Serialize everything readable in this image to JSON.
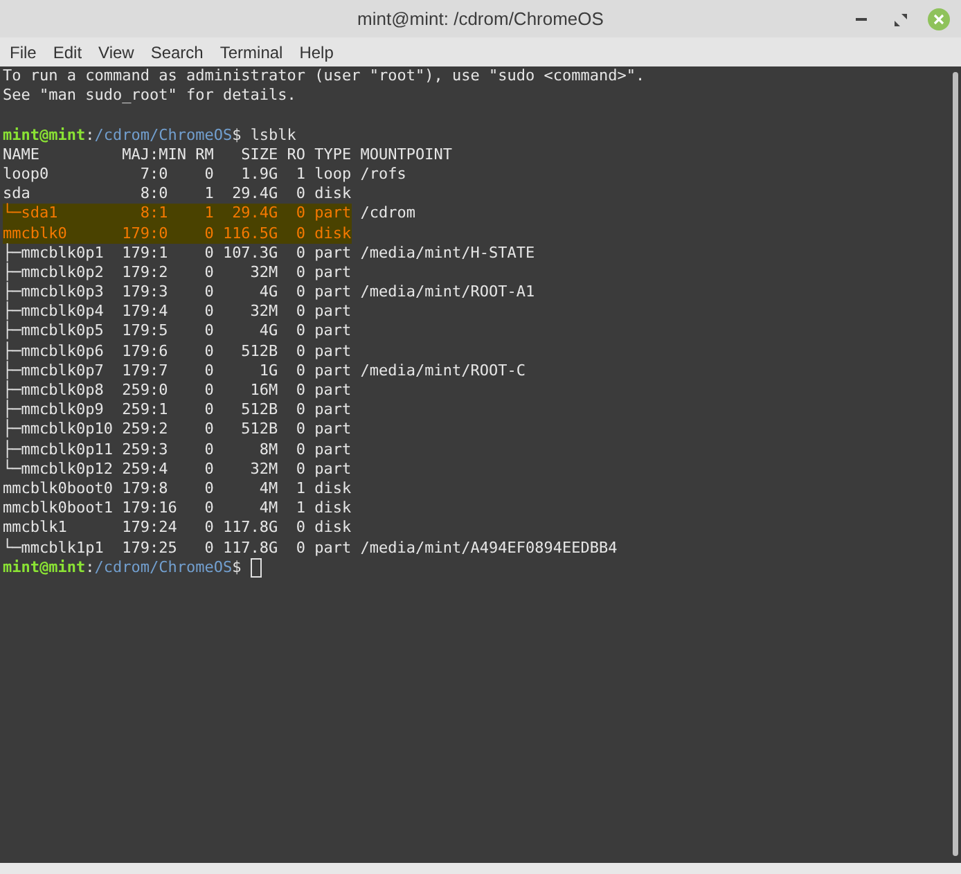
{
  "window": {
    "title": "mint@mint: /cdrom/ChromeOS"
  },
  "menu": [
    "File",
    "Edit",
    "View",
    "Search",
    "Terminal",
    "Help"
  ],
  "terminal": {
    "lines": [
      {
        "kind": "text",
        "text": "To run a command as administrator (user \"root\"), use \"sudo <command>\".",
        "highlighted": false
      },
      {
        "kind": "text",
        "text": "See \"man sudo_root\" for details.",
        "highlighted": false
      },
      {
        "kind": "blank"
      },
      {
        "kind": "prompt",
        "user": "mint@mint",
        "separator": ":",
        "path": "/cdrom/ChromeOS",
        "symbol": "$",
        "command": "lsblk",
        "cursor": false
      },
      {
        "kind": "text",
        "text": "NAME         MAJ:MIN RM   SIZE RO TYPE MOUNTPOINT",
        "highlighted": false
      },
      {
        "kind": "text",
        "text": "loop0          7:0    0   1.9G  1 loop /rofs",
        "highlighted": false
      },
      {
        "kind": "text",
        "text": "sda            8:0    1  29.4G  0 disk",
        "highlighted": false
      },
      {
        "kind": "text",
        "text": "└─sda1         8:1    1  29.4G  0 part",
        "tail": "/cdrom",
        "highlighted": true
      },
      {
        "kind": "text",
        "text": "mmcblk0      179:0    0 116.5G  0 disk",
        "highlighted": true
      },
      {
        "kind": "text",
        "text": "├─mmcblk0p1  179:1    0 107.3G  0 part /media/mint/H-STATE",
        "highlighted": false
      },
      {
        "kind": "text",
        "text": "├─mmcblk0p2  179:2    0    32M  0 part",
        "highlighted": false
      },
      {
        "kind": "text",
        "text": "├─mmcblk0p3  179:3    0     4G  0 part /media/mint/ROOT-A1",
        "highlighted": false
      },
      {
        "kind": "text",
        "text": "├─mmcblk0p4  179:4    0    32M  0 part",
        "highlighted": false
      },
      {
        "kind": "text",
        "text": "├─mmcblk0p5  179:5    0     4G  0 part",
        "highlighted": false
      },
      {
        "kind": "text",
        "text": "├─mmcblk0p6  179:6    0   512B  0 part",
        "highlighted": false
      },
      {
        "kind": "text",
        "text": "├─mmcblk0p7  179:7    0     1G  0 part /media/mint/ROOT-C",
        "highlighted": false
      },
      {
        "kind": "text",
        "text": "├─mmcblk0p8  259:0    0    16M  0 part",
        "highlighted": false
      },
      {
        "kind": "text",
        "text": "├─mmcblk0p9  259:1    0   512B  0 part",
        "highlighted": false
      },
      {
        "kind": "text",
        "text": "├─mmcblk0p10 259:2    0   512B  0 part",
        "highlighted": false
      },
      {
        "kind": "text",
        "text": "├─mmcblk0p11 259:3    0     8M  0 part",
        "highlighted": false
      },
      {
        "kind": "text",
        "text": "└─mmcblk0p12 259:4    0    32M  0 part",
        "highlighted": false
      },
      {
        "kind": "text",
        "text": "mmcblk0boot0 179:8    0     4M  1 disk",
        "highlighted": false
      },
      {
        "kind": "text",
        "text": "mmcblk0boot1 179:16   0     4M  1 disk",
        "highlighted": false
      },
      {
        "kind": "text",
        "text": "mmcblk1      179:24   0 117.8G  0 disk",
        "highlighted": false
      },
      {
        "kind": "text",
        "text": "└─mmcblk1p1  179:25   0 117.8G  0 part /media/mint/A494EF0894EEDBB4",
        "highlighted": false
      },
      {
        "kind": "prompt",
        "user": "mint@mint",
        "separator": ":",
        "path": "/cdrom/ChromeOS",
        "symbol": "$",
        "cursor": true
      }
    ]
  }
}
